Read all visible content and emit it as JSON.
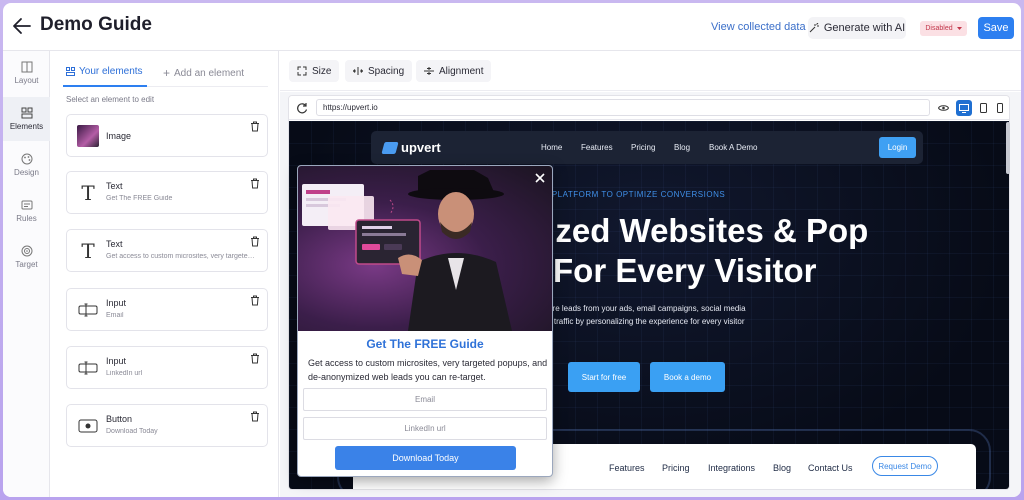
{
  "header": {
    "title": "Demo Guide",
    "view_link": "View collected data",
    "generate_label": "Generate with AI",
    "status": "Disabled",
    "save_label": "Save"
  },
  "rail": {
    "items": [
      {
        "label": "Layout",
        "icon": "layout-icon"
      },
      {
        "label": "Elements",
        "icon": "elements-icon",
        "active": true
      },
      {
        "label": "Design",
        "icon": "palette-icon"
      },
      {
        "label": "Rules",
        "icon": "rules-icon"
      },
      {
        "label": "Target",
        "icon": "target-icon"
      }
    ]
  },
  "panel": {
    "tab_your_elements": "Your elements",
    "tab_add_element": "Add an element",
    "hint": "Select an element to edit",
    "elements": [
      {
        "type": "Image",
        "subtitle": ""
      },
      {
        "type": "Text",
        "subtitle": "Get The FREE Guide"
      },
      {
        "type": "Text",
        "subtitle": "Get access to custom microsites, very targeted popups, and de-anonymized web leads"
      },
      {
        "type": "Input",
        "subtitle": "Email"
      },
      {
        "type": "Input",
        "subtitle": "LinkedIn url"
      },
      {
        "type": "Button",
        "subtitle": "Download Today"
      }
    ]
  },
  "toolbar": {
    "size": "Size",
    "spacing": "Spacing",
    "alignment": "Alignment"
  },
  "browser": {
    "url": "https://upvert.io"
  },
  "site": {
    "logo": "upvert",
    "nav": [
      "Home",
      "Features",
      "Pricing",
      "Blog",
      "Book A Demo"
    ],
    "login": "Login",
    "tagline": "NE PLATFORM TO OPTIMIZE CONVERSIONS",
    "headline_1": "lized Websites & Pop",
    "headline_2": "For Every Visitor",
    "desc_1": "t more leads from your ads, email campaigns, social media",
    "desc_2": "anic traffic by personalizing the experience for every visitor",
    "cta_primary": "Start for free",
    "cta_secondary": "Book a demo",
    "nav2": [
      "Features",
      "Pricing",
      "Integrations",
      "Blog",
      "Contact Us"
    ],
    "request_demo": "Request Demo"
  },
  "popup": {
    "title": "Get The FREE Guide",
    "text": "Get access to custom microsites, very targeted popups, and de-anonymized web leads you can re-target.",
    "email_placeholder": "Email",
    "linkedin_placeholder": "LinkedIn url",
    "button": "Download Today"
  },
  "colors": {
    "accent": "#2d7ff0",
    "site_bg": "#070b17",
    "popup_title": "#2f72d8",
    "disabled_bg": "#fbe0e4"
  }
}
